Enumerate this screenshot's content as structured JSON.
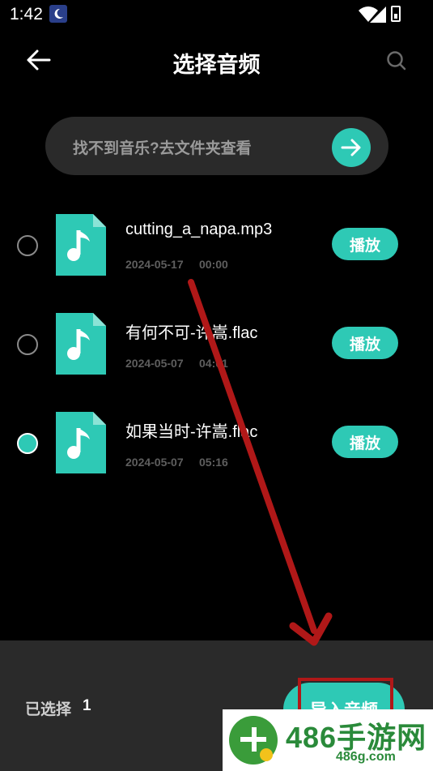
{
  "status_bar": {
    "time": "1:42"
  },
  "header": {
    "title": "选择音频"
  },
  "hint": {
    "text": "找不到音乐?去文件夹查看"
  },
  "files": [
    {
      "name": "cutting_a_napa.mp3",
      "date": "2024-05-17",
      "time": "00:00",
      "selected": false,
      "play_label": "播放"
    },
    {
      "name": "有何不可-许嵩.flac",
      "date": "2024-05-07",
      "time": "04:01",
      "selected": false,
      "play_label": "播放"
    },
    {
      "name": "如果当时-许嵩.flac",
      "date": "2024-05-07",
      "time": "05:16",
      "selected": true,
      "play_label": "播放"
    }
  ],
  "footer": {
    "selected_label": "已选择",
    "selected_count": "1",
    "import_label": "导入音频"
  },
  "watermark": {
    "main": "486手游网",
    "sub": "486g.com"
  },
  "colors": {
    "accent": "#2ec9b5",
    "background": "#000000",
    "panel": "#2a2a2a",
    "annotation": "#b01818"
  }
}
